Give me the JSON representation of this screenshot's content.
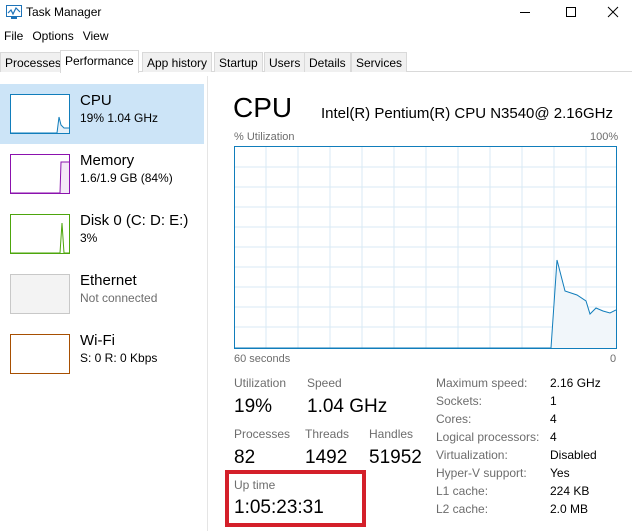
{
  "window": {
    "title": "Task Manager"
  },
  "menu": [
    "File",
    "Options",
    "View"
  ],
  "tabs": [
    {
      "label": "Processes"
    },
    {
      "label": "Performance",
      "active": true
    },
    {
      "label": "App history"
    },
    {
      "label": "Startup"
    },
    {
      "label": "Users"
    },
    {
      "label": "Details"
    },
    {
      "label": "Services"
    }
  ],
  "sidebar": {
    "items": [
      {
        "title": "CPU",
        "sub": "19% 1.04 GHz",
        "color": "#117dbb",
        "selected": true
      },
      {
        "title": "Memory",
        "sub": "1.6/1.9 GB (84%)",
        "color": "#8b12ae"
      },
      {
        "title": "Disk 0 (C: D: E:)",
        "sub": "3%",
        "color": "#4da60c"
      },
      {
        "title": "Ethernet",
        "sub": "Not connected",
        "color": "#a7a7a7"
      },
      {
        "title": "Wi-Fi",
        "sub": "S: 0 R: 0 Kbps",
        "color": "#a74f01"
      }
    ]
  },
  "main": {
    "title": "CPU",
    "model": "Intel(R) Pentium(R) CPU N3540@ 2.16GHz",
    "graph": {
      "y_label": "% Utilization",
      "y_max_label": "100%",
      "x_label": "60 seconds",
      "x_min_label": "0",
      "line_color": "#117dbb",
      "fill_color": "#f1f6fa"
    },
    "stats": {
      "utilization_label": "Utilization",
      "utilization": "19%",
      "speed_label": "Speed",
      "speed": "1.04 GHz",
      "processes_label": "Processes",
      "processes": "82",
      "threads_label": "Threads",
      "threads": "1492",
      "handles_label": "Handles",
      "handles": "51952",
      "uptime_label": "Up time",
      "uptime": "1:05:23:31"
    },
    "specs": [
      {
        "key": "Maximum speed:",
        "value": "2.16 GHz"
      },
      {
        "key": "Sockets:",
        "value": "1"
      },
      {
        "key": "Cores:",
        "value": "4"
      },
      {
        "key": "Logical processors:",
        "value": "4"
      },
      {
        "key": "Virtualization:",
        "value": "Disabled"
      },
      {
        "key": "Hyper-V support:",
        "value": "Yes"
      },
      {
        "key": "L1 cache:",
        "value": "224 KB"
      },
      {
        "key": "L2 cache:",
        "value": "2.0 MB"
      }
    ]
  },
  "highlight_color": "#d4202a"
}
